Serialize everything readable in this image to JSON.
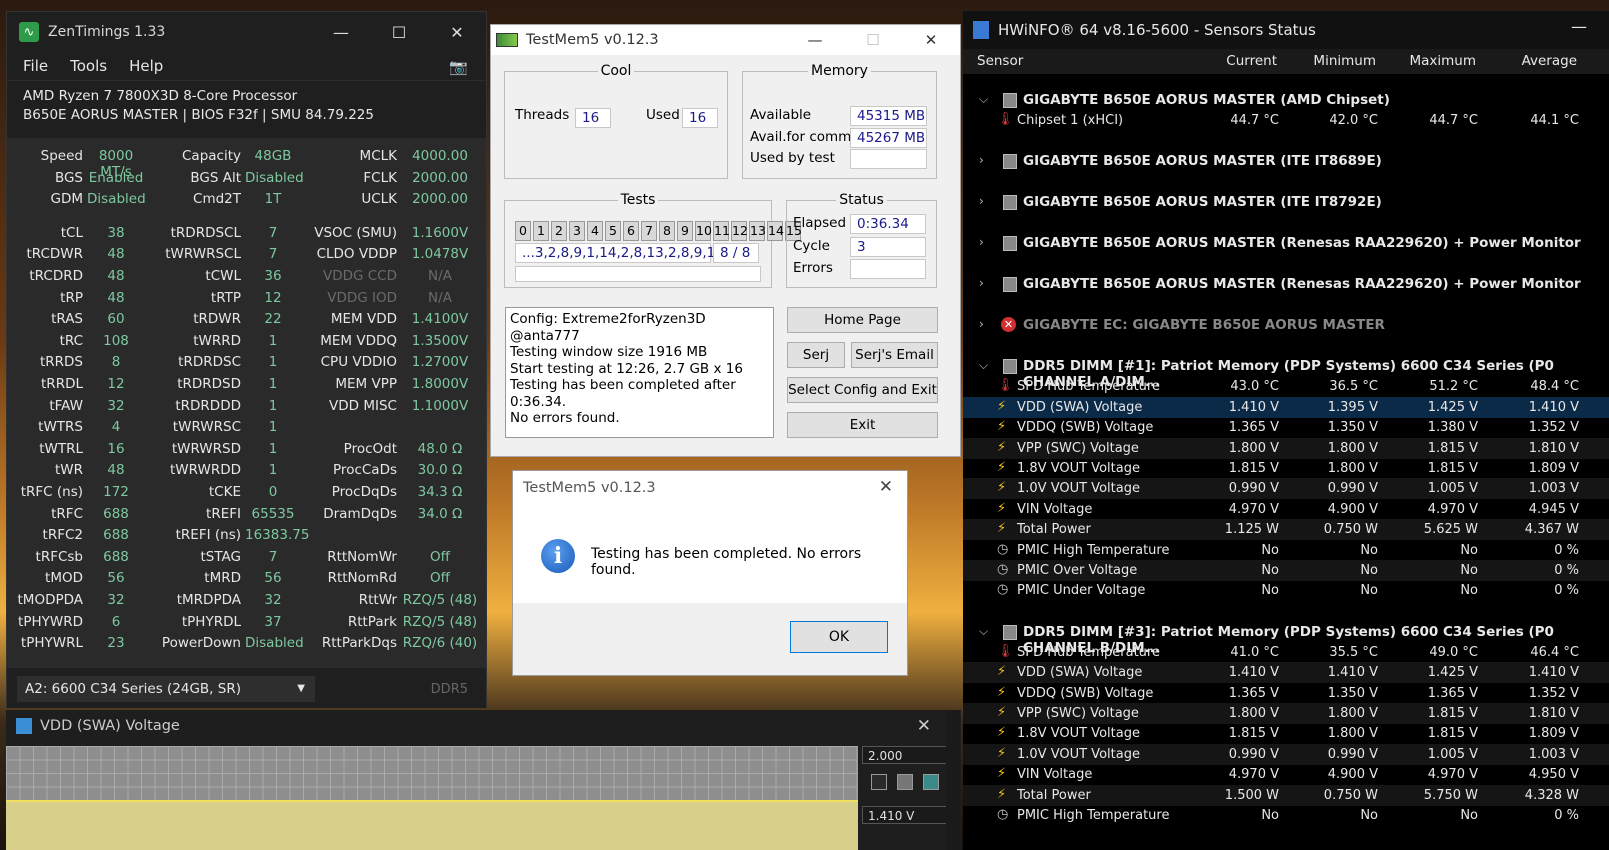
{
  "zentimings": {
    "title": "ZenTimings 1.33",
    "menu": [
      "File",
      "Tools",
      "Help"
    ],
    "cpu": "AMD Ryzen 7 7800X3D 8-Core Processor",
    "board": "B650E AORUS MASTER | BIOS F32f | SMU 84.79.225",
    "rows": [
      [
        "Speed",
        "8000 MT/s",
        "Capacity",
        "48GB",
        "MCLK",
        "4000.00"
      ],
      [
        "BGS",
        "Enabled",
        "BGS Alt",
        "Disabled",
        "FCLK",
        "2000.00"
      ],
      [
        "GDM",
        "Disabled",
        "Cmd2T",
        "1T",
        "UCLK",
        "2000.00"
      ],
      [
        "tCL",
        "38",
        "tRDRDSCL",
        "7",
        "VSOC (SMU)",
        "1.1600V"
      ],
      [
        "tRCDWR",
        "48",
        "tWRWRSCL",
        "7",
        "CLDO VDDP",
        "1.0478V"
      ],
      [
        "tRCDRD",
        "48",
        "tCWL",
        "36",
        "VDDG CCD",
        "N/A"
      ],
      [
        "tRP",
        "48",
        "tRTP",
        "12",
        "VDDG IOD",
        "N/A"
      ],
      [
        "tRAS",
        "60",
        "tRDWR",
        "22",
        "MEM VDD",
        "1.4100V"
      ],
      [
        "tRC",
        "108",
        "tWRRD",
        "1",
        "MEM VDDQ",
        "1.3500V"
      ],
      [
        "tRRDS",
        "8",
        "tRDRDSC",
        "1",
        "CPU VDDIO",
        "1.2700V"
      ],
      [
        "tRRDL",
        "12",
        "tRDRDSD",
        "1",
        "MEM VPP",
        "1.8000V"
      ],
      [
        "tFAW",
        "32",
        "tRDRDDD",
        "1",
        "VDD MISC",
        "1.1000V"
      ],
      [
        "tWTRS",
        "4",
        "tWRWRSC",
        "1",
        "",
        ""
      ],
      [
        "tWTRL",
        "16",
        "tWRWRSD",
        "1",
        "ProcOdt",
        "48.0 Ω"
      ],
      [
        "tWR",
        "48",
        "tWRWRDD",
        "1",
        "ProcCaDs",
        "30.0 Ω"
      ],
      [
        "tRFC (ns)",
        "172",
        "tCKE",
        "0",
        "ProcDqDs",
        "34.3 Ω"
      ],
      [
        "tRFC",
        "688",
        "tREFI",
        "65535",
        "DramDqDs",
        "34.0 Ω"
      ],
      [
        "tRFC2",
        "688",
        "tREFI (ns)",
        "16383.75",
        "",
        ""
      ],
      [
        "tRFCsb",
        "688",
        "tSTAG",
        "7",
        "RttNomWr",
        "Off"
      ],
      [
        "tMOD",
        "56",
        "tMRD",
        "56",
        "RttNomRd",
        "Off"
      ],
      [
        "tMODPDA",
        "32",
        "tMRDPDA",
        "32",
        "RttWr",
        "RZQ/5 (48)"
      ],
      [
        "tPHYWRD",
        "6",
        "tPHYRDL",
        "37",
        "RttPark",
        "RZQ/5 (48)"
      ],
      [
        "tPHYWRL",
        "23",
        "PowerDown",
        "Disabled",
        "RttParkDqs",
        "RZQ/6 (40)"
      ]
    ],
    "module_select": "A2: 6600 C34 Series (24GB, SR)",
    "ddr_label": "DDR5"
  },
  "graph": {
    "title": "VDD (SWA) Voltage",
    "max_value": "2.000",
    "current_value": "1.410 V"
  },
  "testmem": {
    "title": "TestMem5 v0.12.3",
    "cool": {
      "heading": "Cool",
      "threads_label": "Threads",
      "threads": "16",
      "used_label": "Used",
      "used": "16"
    },
    "memory": {
      "heading": "Memory",
      "available_label": "Available",
      "available": "45315 MB",
      "commit_label": "Avail.for commit",
      "commit": "45267 MB",
      "used_label": "Used by test",
      "used": ""
    },
    "tests": {
      "heading": "Tests",
      "cells": [
        "0",
        "1",
        "2",
        "3",
        "4",
        "5",
        "6",
        "7",
        "8",
        "9",
        "10",
        "11",
        "12",
        "13",
        "14",
        "15"
      ],
      "sequence": "...3,2,8,9,1,14,2,8,13,2,8,9,1",
      "progress": "8 / 8"
    },
    "status": {
      "heading": "Status",
      "elapsed_label": "Elapsed",
      "elapsed": "0:36.34",
      "cycle_label": "Cycle",
      "cycle": "3",
      "errors_label": "Errors",
      "errors": ""
    },
    "log": [
      "Config: Extreme2forRyzen3D @anta777",
      "Testing window size 1916 MB",
      "Start testing at 12:26, 2.7 GB x 16",
      "Testing has been completed after 0:36.34.",
      "No errors found."
    ],
    "buttons": {
      "home": "Home Page",
      "serj": "Serj",
      "serj_email": "Serj's Email",
      "select": "Select Config and Exit",
      "exit": "Exit"
    }
  },
  "dialog": {
    "title": "TestMem5 v0.12.3",
    "message": "Testing has been completed. No errors found.",
    "ok": "OK"
  },
  "hwinfo": {
    "title": "HWiNFO® 64 v8.16-5600 - Sensors Status",
    "columns": [
      "Sensor",
      "Current",
      "Minimum",
      "Maximum",
      "Average"
    ],
    "groups": [
      {
        "name": "GIGABYTE B650E AORUS MASTER (AMD Chipset)",
        "expanded": true,
        "rows": [
          {
            "icon": "temp",
            "name": "Chipset 1 (xHCI)",
            "v": [
              "44.7 °C",
              "42.0 °C",
              "44.7 °C",
              "44.1 °C"
            ]
          }
        ]
      },
      {
        "name": "GIGABYTE B650E AORUS MASTER (ITE IT8689E)",
        "expanded": false,
        "rows": []
      },
      {
        "name": "GIGABYTE B650E AORUS MASTER (ITE IT8792E)",
        "expanded": false,
        "rows": []
      },
      {
        "name": "GIGABYTE B650E AORUS MASTER (Renesas RAA229620) + Power Monitor",
        "expanded": false,
        "rows": []
      },
      {
        "name": "GIGABYTE B650E AORUS MASTER (Renesas RAA229620) + Power Monitor",
        "expanded": false,
        "rows": []
      },
      {
        "name": "GIGABYTE EC: GIGABYTE B650E AORUS MASTER",
        "expanded": false,
        "error": true,
        "rows": []
      },
      {
        "name": "DDR5 DIMM [#1]: Patriot Memory (PDP Systems) 6600 C34 Series (P0 CHANNEL A/DIM...",
        "expanded": true,
        "rows": [
          {
            "icon": "temp",
            "name": "SPD Hub Temperature",
            "v": [
              "43.0 °C",
              "36.5 °C",
              "51.2 °C",
              "48.4 °C"
            ]
          },
          {
            "icon": "volt",
            "name": "VDD (SWA) Voltage",
            "v": [
              "1.410 V",
              "1.395 V",
              "1.425 V",
              "1.410 V"
            ],
            "selected": true
          },
          {
            "icon": "volt",
            "name": "VDDQ (SWB) Voltage",
            "v": [
              "1.365 V",
              "1.350 V",
              "1.380 V",
              "1.352 V"
            ]
          },
          {
            "icon": "volt",
            "name": "VPP (SWC) Voltage",
            "v": [
              "1.800 V",
              "1.800 V",
              "1.815 V",
              "1.810 V"
            ]
          },
          {
            "icon": "volt",
            "name": "1.8V VOUT Voltage",
            "v": [
              "1.815 V",
              "1.800 V",
              "1.815 V",
              "1.809 V"
            ]
          },
          {
            "icon": "volt",
            "name": "1.0V VOUT Voltage",
            "v": [
              "0.990 V",
              "0.990 V",
              "1.005 V",
              "1.003 V"
            ]
          },
          {
            "icon": "volt",
            "name": "VIN Voltage",
            "v": [
              "4.970 V",
              "4.900 V",
              "4.970 V",
              "4.945 V"
            ]
          },
          {
            "icon": "volt",
            "name": "Total Power",
            "v": [
              "1.125 W",
              "0.750 W",
              "5.625 W",
              "4.367 W"
            ]
          },
          {
            "icon": "clock",
            "name": "PMIC High Temperature",
            "v": [
              "No",
              "No",
              "No",
              "0 %"
            ]
          },
          {
            "icon": "clock",
            "name": "PMIC Over Voltage",
            "v": [
              "No",
              "No",
              "No",
              "0 %"
            ]
          },
          {
            "icon": "clock",
            "name": "PMIC Under Voltage",
            "v": [
              "No",
              "No",
              "No",
              "0 %"
            ]
          }
        ]
      },
      {
        "name": "DDR5 DIMM [#3]: Patriot Memory (PDP Systems) 6600 C34 Series (P0 CHANNEL B/DIM...",
        "expanded": true,
        "rows": [
          {
            "icon": "temp",
            "name": "SPD Hub Temperature",
            "v": [
              "41.0 °C",
              "35.5 °C",
              "49.0 °C",
              "46.4 °C"
            ]
          },
          {
            "icon": "volt",
            "name": "VDD (SWA) Voltage",
            "v": [
              "1.410 V",
              "1.410 V",
              "1.425 V",
              "1.410 V"
            ]
          },
          {
            "icon": "volt",
            "name": "VDDQ (SWB) Voltage",
            "v": [
              "1.365 V",
              "1.350 V",
              "1.365 V",
              "1.352 V"
            ]
          },
          {
            "icon": "volt",
            "name": "VPP (SWC) Voltage",
            "v": [
              "1.800 V",
              "1.800 V",
              "1.815 V",
              "1.810 V"
            ]
          },
          {
            "icon": "volt",
            "name": "1.8V VOUT Voltage",
            "v": [
              "1.815 V",
              "1.800 V",
              "1.815 V",
              "1.809 V"
            ]
          },
          {
            "icon": "volt",
            "name": "1.0V VOUT Voltage",
            "v": [
              "0.990 V",
              "0.990 V",
              "1.005 V",
              "1.003 V"
            ]
          },
          {
            "icon": "volt",
            "name": "VIN Voltage",
            "v": [
              "4.970 V",
              "4.900 V",
              "4.970 V",
              "4.950 V"
            ]
          },
          {
            "icon": "volt",
            "name": "Total Power",
            "v": [
              "1.500 W",
              "0.750 W",
              "5.750 W",
              "4.328 W"
            ]
          },
          {
            "icon": "clock",
            "name": "PMIC High Temperature",
            "v": [
              "No",
              "No",
              "No",
              "0 %"
            ]
          }
        ]
      }
    ]
  }
}
